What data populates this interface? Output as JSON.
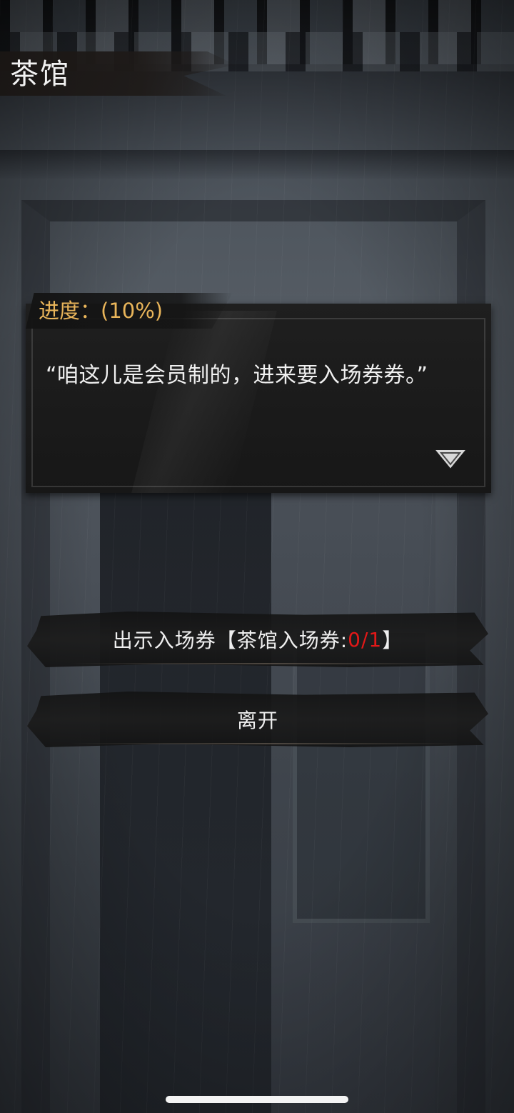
{
  "location": {
    "title": "茶馆"
  },
  "dialog": {
    "progress_label": "进度：(10%)",
    "text": "“咱这儿是会员制的，进来要入场券券。”"
  },
  "options": [
    {
      "prefix": "出示入场券【茶馆入场券:",
      "count": "0/1",
      "suffix": "】"
    },
    {
      "label": "离开"
    }
  ],
  "icons": {
    "next": "down-triangle-icon"
  },
  "colors": {
    "progress_text": "#e9b55a",
    "count_insufficient": "#e21818"
  }
}
